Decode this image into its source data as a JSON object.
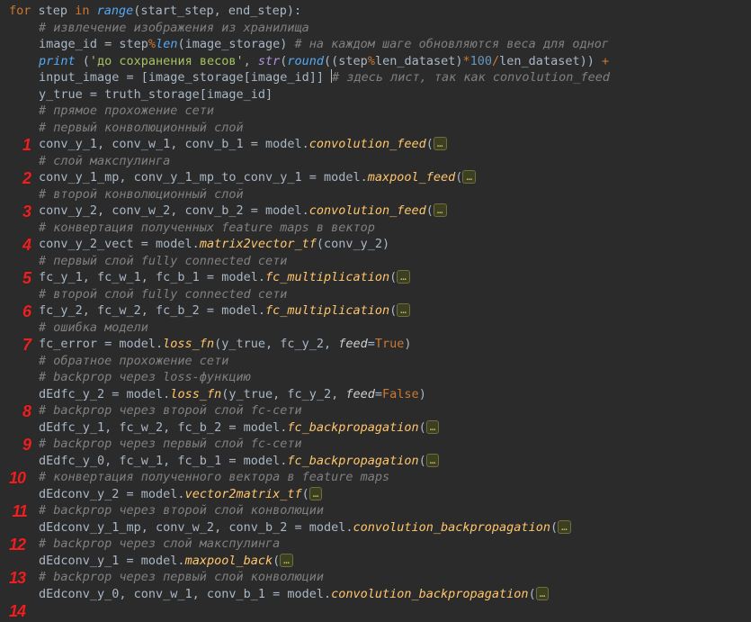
{
  "header": {
    "for": "for",
    "step": "step",
    "in": "in",
    "range": "range",
    "args": "(start_step, end_step):"
  },
  "l2_cmt": "# извлечение изображения из хранилища",
  "l3a": "image_id = step",
  "l3_op": "%",
  "l3_len": "len",
  "l3_args": "(image_storage)",
  "l3_cmt": " # на каждом шаге обновляются веса для одног",
  "l4_print": "print",
  "l4_p1": " (",
  "l4_str": "'до сохранения весов'",
  "l4_c": ", ",
  "l4_stru": "str",
  "l4_inner1": "(",
  "l4_round": "round",
  "l4_inner2": "((step",
  "l4_mod": "%",
  "l4_ld": "len_dataset)",
  "l4_mul": "*",
  "l4_100": "100",
  "l4_div": "/",
  "l4_ld2": "len_dataset)) ",
  "l4_plus": "+",
  "l5a": "input_image = [image_storage[image_id]] ",
  "l5_cmt": "# здесь лист, так как convolution_feed",
  "l6": "y_true = truth_storage[image_id]",
  "l7_cmt": "# прямое прохожение сети",
  "l8_cmt": "# первый конволюционный слой",
  "r1": "conv_y_1, conv_w_1, conv_b_1 = model.",
  "r1_fn": "convolution_feed",
  "r1_p": "(",
  "l10_cmt": "# слой макспулинга",
  "r2": "conv_y_1_mp, conv_y_1_mp_to_conv_y_1 = model.",
  "r2_fn": "maxpool_feed",
  "r2_p": "(",
  "l12_cmt": "# второй конволюционный слой",
  "r3": "conv_y_2, conv_w_2, conv_b_2 = model.",
  "r3_fn": "convolution_feed",
  "r3_p": "(",
  "l14_cmt": "# конвертация полученных feature maps в вектор",
  "r4": "conv_y_2_vect = model.",
  "r4_fn": "matrix2vector_tf",
  "r4_arg": "(conv_y_2)",
  "l16_cmt": "# первый слой fully connected сети",
  "r5": "fc_y_1, fc_w_1, fc_b_1 = model.",
  "r5_fn": "fc_multiplication",
  "r5_p": "(",
  "l18_cmt": "# второй слой fully connected сети",
  "r6": "fc_y_2, fc_w_2, fc_b_2 = model.",
  "r6_fn": "fc_multiplication",
  "r6_p": "(",
  "l20_cmt": "# ошибка модели",
  "r7": "fc_error = model.",
  "r7_fn": "loss_fn",
  "r7_args1": "(y_true, fc_y_2, ",
  "r7_feed": "feed",
  "r7_eq": "=",
  "r7_true": "True",
  "r7_cl": ")",
  "l22_cmt": "# обратное прохожение сети",
  "l23_cmt": "# backprop через loss-функцию",
  "r8": "dEdfc_y_2 = model.",
  "r8_fn": "loss_fn",
  "r8_args1": "(y_true, fc_y_2, ",
  "r8_feed": "feed",
  "r8_eq": "=",
  "r8_false": "False",
  "r8_cl": ")",
  "l25_cmt": "# backprop через второй слой fc-сети",
  "r9": "dEdfc_y_1, fc_w_2, fc_b_2 = model.",
  "r9_fn": "fc_backpropagation",
  "r9_p": "(",
  "l27_cmt": "# backprop через первый слой fc-сети",
  "r10": "dEdfc_y_0, fc_w_1, fc_b_1 = model.",
  "r10_fn": "fc_backpropagation",
  "r10_p": "(",
  "l29_cmt": "# конвертация полученного вектора в feature maps",
  "r11": "dEdconv_y_2 = model.",
  "r11_fn": "vector2matrix_tf",
  "r11_p": "(",
  "l31_cmt": "# backprop через второй слой конволюции",
  "r12": "dEdconv_y_1_mp, conv_w_2, conv_b_2 = model.",
  "r12_fn": "convolution_backpropagation",
  "r12_p": "(",
  "l33_cmt": "# backprop через слой макспулинга",
  "r13": "dEdconv_y_1 = model.",
  "r13_fn": "maxpool_back",
  "r13_p": "(",
  "l35_cmt": "# backprop через первый слой конволюции",
  "r14": "dEdconv_y_0, conv_w_1, conv_b_1 = model.",
  "r14_fn": "convolution_backpropagation",
  "r14_p": "(",
  "fold": "…",
  "gutter": [
    "1",
    "2",
    "3",
    "4",
    "5",
    "6",
    "7",
    "8",
    "9",
    "10",
    "11",
    "12",
    "13",
    "14"
  ]
}
